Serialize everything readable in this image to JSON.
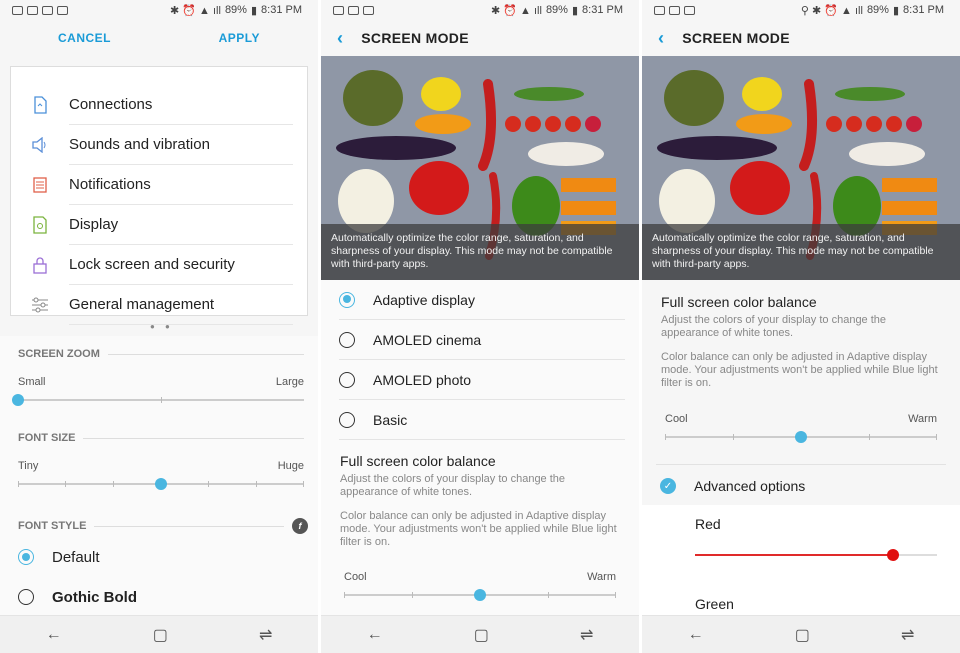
{
  "status": {
    "battery": "89%",
    "time": "8:31 PM"
  },
  "panel1": {
    "cancel": "CANCEL",
    "apply": "APPLY",
    "menu": [
      {
        "label": "Connections",
        "icon": "connections-icon",
        "color": "#4a90d9"
      },
      {
        "label": "Sounds and vibration",
        "icon": "speaker-icon",
        "color": "#5b8fd8"
      },
      {
        "label": "Notifications",
        "icon": "notifications-icon",
        "color": "#e0604a"
      },
      {
        "label": "Display",
        "icon": "display-icon",
        "color": "#7bb33d"
      },
      {
        "label": "Lock screen and security",
        "icon": "lock-icon",
        "color": "#9b6fd6"
      },
      {
        "label": "General management",
        "icon": "sliders-icon",
        "color": "#888888"
      }
    ],
    "screen_zoom": {
      "title": "SCREEN ZOOM",
      "min": "Small",
      "max": "Large",
      "value": 0
    },
    "font_size": {
      "title": "FONT SIZE",
      "min": "Tiny",
      "max": "Huge",
      "value": 0.5
    },
    "font_style": {
      "title": "FONT STYLE",
      "options": [
        "Default",
        "Gothic Bold"
      ],
      "selected": "Default"
    }
  },
  "panel2": {
    "title": "SCREEN MODE",
    "caption": "Automatically optimize the color range, saturation, and sharpness of your display. This mode may not be compatible with third-party apps.",
    "options": [
      "Adaptive display",
      "AMOLED cinema",
      "AMOLED photo",
      "Basic"
    ],
    "selected": "Adaptive display",
    "balance_title": "Full screen color balance",
    "balance_desc": "Adjust the colors of your display to change the appearance of white tones.",
    "balance_note": "Color balance can only be adjusted in Adaptive display mode. Your adjustments won't be applied while Blue light filter is on.",
    "cool": "Cool",
    "warm": "Warm",
    "balance_value": 0.5
  },
  "panel3": {
    "title": "SCREEN MODE",
    "caption": "Automatically optimize the color range, saturation, and sharpness of your display. This mode may not be compatible with third-party apps.",
    "balance_title": "Full screen color balance",
    "balance_desc": "Adjust the colors of your display to change the appearance of white tones.",
    "balance_note": "Color balance can only be adjusted in Adaptive display mode. Your adjustments won't be applied while Blue light filter is on.",
    "cool": "Cool",
    "warm": "Warm",
    "balance_value": 0.5,
    "advanced": "Advanced options",
    "red": "Red",
    "red_value": 0.82,
    "green": "Green"
  }
}
